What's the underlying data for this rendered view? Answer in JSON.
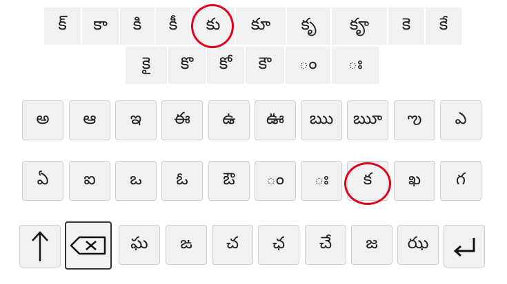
{
  "suggestions_row1": [
    "క్",
    "కా",
    "కి",
    "కీ",
    "కు",
    "కూ",
    "కృ",
    "కౄ",
    "కె",
    "కే"
  ],
  "suggestions_row2": [
    "కై",
    "కొ",
    "కో",
    "కౌ",
    "ం",
    "ః"
  ],
  "row1": [
    "అ",
    "ఆ",
    "ఇ",
    "ఈ",
    "ఉ",
    "ఊ",
    "ఋ",
    "ౠ",
    "ఌ",
    "ఎ"
  ],
  "row2": [
    "ఏ",
    "ఐ",
    "ఒ",
    "ఓ",
    "ఔ",
    "ం",
    "ః",
    "క",
    "ఖ",
    "గ"
  ],
  "row3": [
    "ఘ",
    "ఙ",
    "చ",
    "ఛ",
    "చే",
    "జ",
    "ఝ"
  ],
  "icons": {
    "shift": "shift-icon",
    "backspace": "backspace-icon",
    "enter": "enter-icon"
  },
  "highlight_color": "#e3001b"
}
